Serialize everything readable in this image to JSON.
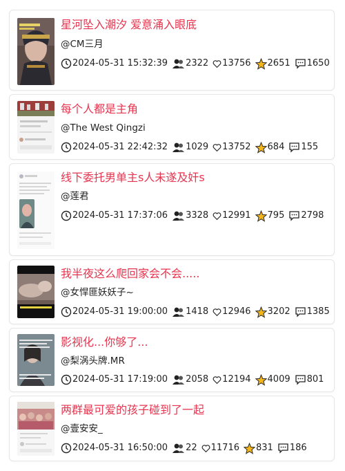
{
  "colors": {
    "title": "#e8344e",
    "star": "#f2b51c",
    "text": "#222222"
  },
  "icons": {
    "time": "clock-icon",
    "views": "users-icon",
    "likes": "heart-icon",
    "favorites": "star-icon",
    "comments": "comment-icon"
  },
  "items": [
    {
      "title": "星河坠入潮汐 爱意涌入眼底",
      "author": "@CM三月",
      "time": "2024-05-31 15:32:39",
      "views": "2322",
      "likes": "13756",
      "favorites": "2651",
      "comments": "1650"
    },
    {
      "title": "每个人都是主角",
      "author": "@The West Qingzi",
      "time": "2024-05-31 22:42:32",
      "views": "1029",
      "likes": "13752",
      "favorites": "684",
      "comments": "155"
    },
    {
      "title": "线下委托男单主s人未遂及奸s",
      "author": "@莲君",
      "time": "2024-05-31 17:37:06",
      "views": "3328",
      "likes": "12991",
      "favorites": "795",
      "comments": "2798"
    },
    {
      "title": "我半夜这么爬回家会不会.....",
      "author": "@女悍匪妖妖子~",
      "time": "2024-05-31 19:00:00",
      "views": "1418",
      "likes": "12946",
      "favorites": "3202",
      "comments": "1385"
    },
    {
      "title": "影视化...你够了...",
      "author": "@梨涡头牌.MR",
      "time": "2024-05-31 17:19:00",
      "views": "2058",
      "likes": "12194",
      "favorites": "4009",
      "comments": "801"
    },
    {
      "title": "两群最可爱的孩子碰到了一起",
      "author": "@壹安安_",
      "time": "2024-05-31 16:50:00",
      "views": "22",
      "likes": "11716",
      "favorites": "831",
      "comments": "186"
    }
  ]
}
